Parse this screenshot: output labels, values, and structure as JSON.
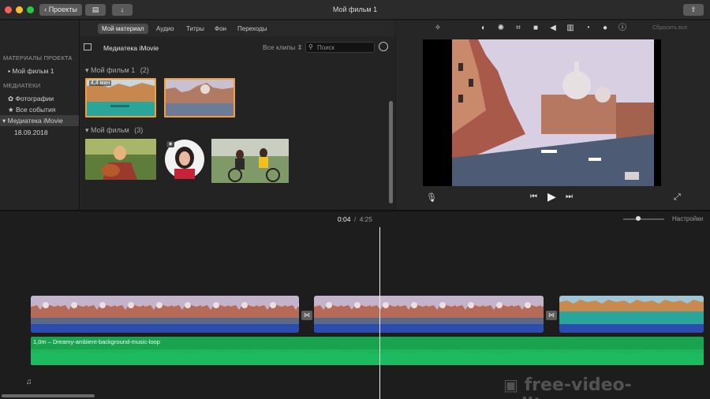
{
  "window": {
    "title": "Мой фильм 1",
    "back_label": "Проекты"
  },
  "tabs": [
    {
      "label": "Мой материал",
      "active": true
    },
    {
      "label": "Аудио",
      "active": false
    },
    {
      "label": "Титры",
      "active": false
    },
    {
      "label": "Фон",
      "active": false
    },
    {
      "label": "Переходы",
      "active": false
    }
  ],
  "sidebar": {
    "projects_heading": "МАТЕРИАЛЫ ПРОЕКТА",
    "project_item": "Мой фильм 1",
    "libraries_heading": "МЕДИАТЕКИ",
    "photos_item": "Фотографии",
    "all_events_item": "Все события",
    "library_item": "Медиатека iMovie",
    "date_item": "18.09.2018"
  },
  "browser": {
    "title": "Медиатека iMovie",
    "filter": "Все клипы",
    "search_placeholder": "Поиск",
    "group1_label": "Мой фильм 1",
    "group1_count": "(2)",
    "group2_label": "Мой фильм",
    "group2_count": "(3)",
    "clip_duration": "4,4 мин"
  },
  "viewer": {
    "reset_label": "Сбросить все"
  },
  "timeline": {
    "current_time": "0:04",
    "separator": "/",
    "total_time": "4:25",
    "settings_label": "Настройки",
    "audio_label": "1,0m – Dreamy-ambient-background-music-loop"
  },
  "watermark": "free-video-editors.ru",
  "colors": {
    "accent": "#f0a040",
    "audio": "#19a34f",
    "clip_blue": "#2d4cb0",
    "selected": "#4b4b4b"
  },
  "icons": [
    "back-chevron-icon",
    "library-icon",
    "download-icon",
    "share-icon",
    "magic-wand-icon",
    "color-balance-icon",
    "palette-icon",
    "crop-icon",
    "camera-icon",
    "volume-icon",
    "equalizer-icon",
    "speed-icon",
    "filter-icon",
    "info-icon",
    "microphone-icon",
    "skip-back-icon",
    "play-icon",
    "skip-forward-icon",
    "fullscreen-icon",
    "music-note-icon"
  ]
}
